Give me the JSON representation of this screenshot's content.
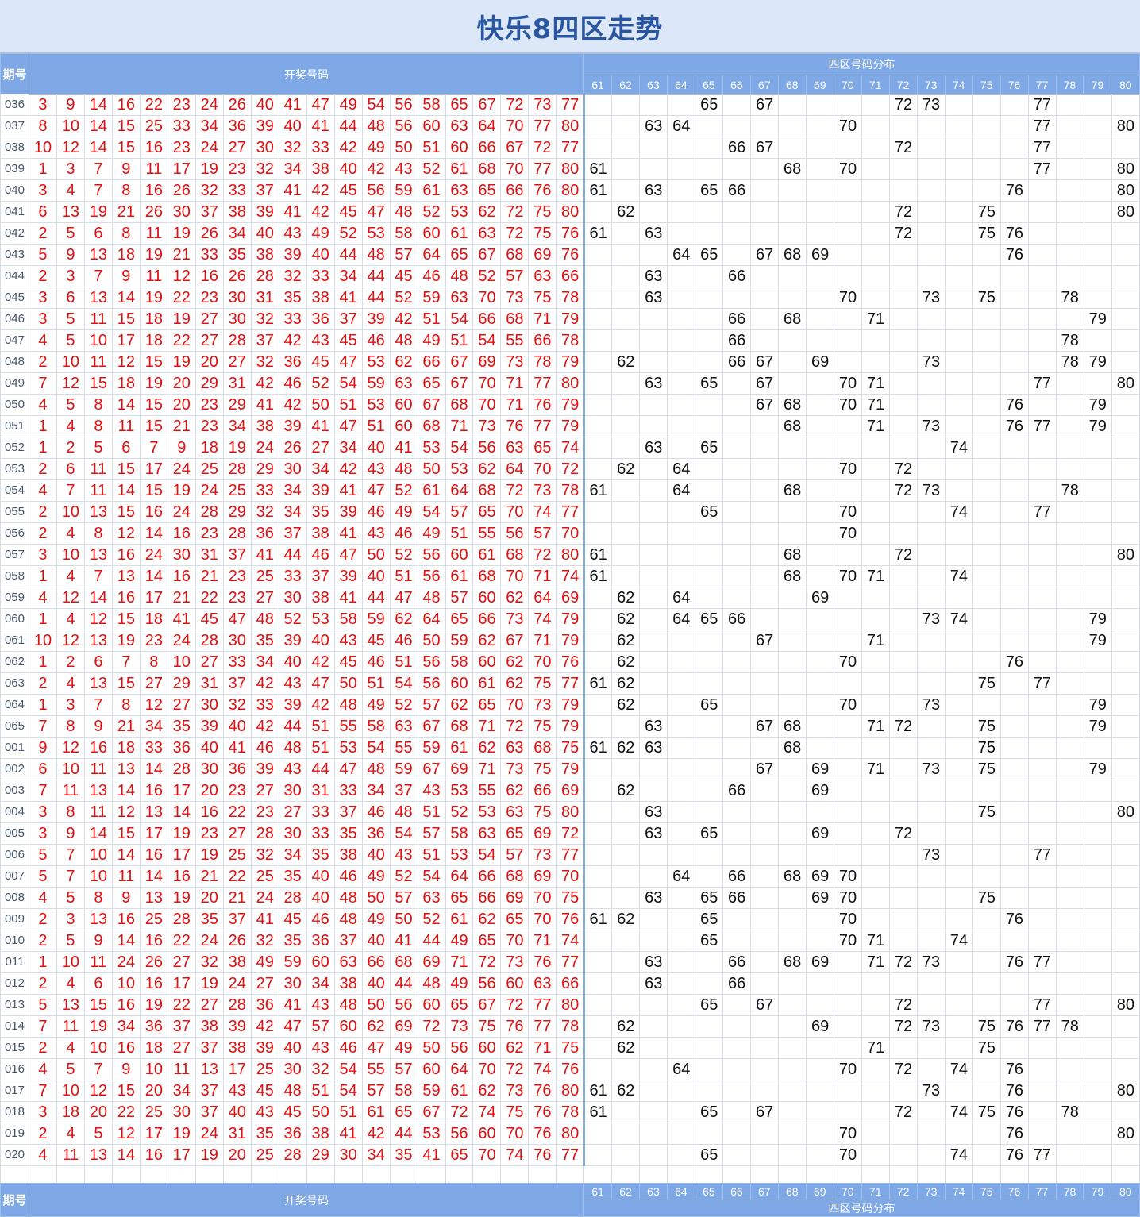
{
  "title": "快乐8四区走势",
  "header": {
    "period_label": "期号",
    "draw_label": "开奖号码",
    "dist_label": "四区号码分布",
    "dist_columns": [
      "61",
      "62",
      "63",
      "64",
      "65",
      "66",
      "67",
      "68",
      "69",
      "70",
      "71",
      "72",
      "73",
      "74",
      "75",
      "76",
      "77",
      "78",
      "79",
      "80"
    ]
  },
  "rows": [
    {
      "period": "036",
      "nums": [
        3,
        9,
        14,
        16,
        22,
        23,
        24,
        26,
        40,
        41,
        47,
        49,
        54,
        56,
        58,
        65,
        67,
        72,
        73,
        77
      ]
    },
    {
      "period": "037",
      "nums": [
        8,
        10,
        14,
        15,
        25,
        33,
        34,
        36,
        39,
        40,
        41,
        44,
        48,
        56,
        60,
        63,
        64,
        70,
        77,
        80
      ]
    },
    {
      "period": "038",
      "nums": [
        10,
        12,
        14,
        15,
        16,
        23,
        24,
        27,
        30,
        32,
        33,
        42,
        49,
        50,
        51,
        60,
        66,
        67,
        72,
        77
      ]
    },
    {
      "period": "039",
      "nums": [
        1,
        3,
        7,
        9,
        11,
        17,
        19,
        23,
        32,
        34,
        38,
        40,
        42,
        43,
        52,
        61,
        68,
        70,
        77,
        80
      ]
    },
    {
      "period": "040",
      "nums": [
        3,
        4,
        7,
        8,
        16,
        26,
        32,
        33,
        37,
        41,
        42,
        45,
        56,
        59,
        61,
        63,
        65,
        66,
        76,
        80
      ]
    },
    {
      "period": "041",
      "nums": [
        6,
        13,
        19,
        21,
        26,
        30,
        37,
        38,
        39,
        41,
        42,
        45,
        47,
        48,
        52,
        53,
        62,
        72,
        75,
        80
      ]
    },
    {
      "period": "042",
      "nums": [
        2,
        5,
        6,
        8,
        11,
        19,
        26,
        34,
        40,
        43,
        49,
        52,
        53,
        58,
        60,
        61,
        63,
        72,
        75,
        76
      ]
    },
    {
      "period": "043",
      "nums": [
        5,
        9,
        13,
        18,
        19,
        21,
        33,
        35,
        38,
        39,
        40,
        44,
        48,
        57,
        64,
        65,
        67,
        68,
        69,
        76
      ]
    },
    {
      "period": "044",
      "nums": [
        2,
        3,
        7,
        9,
        11,
        12,
        16,
        26,
        28,
        32,
        33,
        34,
        44,
        45,
        46,
        48,
        52,
        57,
        63,
        66
      ]
    },
    {
      "period": "045",
      "nums": [
        3,
        6,
        13,
        14,
        19,
        22,
        23,
        30,
        31,
        35,
        38,
        41,
        44,
        52,
        59,
        63,
        70,
        73,
        75,
        78
      ]
    },
    {
      "period": "046",
      "nums": [
        3,
        5,
        11,
        15,
        18,
        19,
        27,
        30,
        32,
        33,
        36,
        37,
        39,
        42,
        51,
        54,
        66,
        68,
        71,
        79
      ]
    },
    {
      "period": "047",
      "nums": [
        4,
        5,
        10,
        17,
        18,
        22,
        27,
        28,
        37,
        42,
        43,
        45,
        46,
        48,
        49,
        51,
        54,
        55,
        66,
        78
      ]
    },
    {
      "period": "048",
      "nums": [
        2,
        10,
        11,
        12,
        15,
        19,
        20,
        27,
        32,
        36,
        45,
        47,
        53,
        62,
        66,
        67,
        69,
        73,
        78,
        79
      ]
    },
    {
      "period": "049",
      "nums": [
        7,
        12,
        15,
        18,
        19,
        20,
        29,
        31,
        42,
        46,
        52,
        54,
        59,
        63,
        65,
        67,
        70,
        71,
        77,
        80
      ]
    },
    {
      "period": "050",
      "nums": [
        4,
        5,
        8,
        14,
        15,
        20,
        23,
        29,
        41,
        42,
        50,
        51,
        53,
        60,
        67,
        68,
        70,
        71,
        76,
        79
      ]
    },
    {
      "period": "051",
      "nums": [
        1,
        4,
        8,
        11,
        15,
        21,
        23,
        34,
        38,
        39,
        41,
        47,
        51,
        60,
        68,
        71,
        73,
        76,
        77,
        79
      ]
    },
    {
      "period": "052",
      "nums": [
        1,
        2,
        5,
        6,
        7,
        9,
        18,
        19,
        24,
        26,
        27,
        34,
        40,
        41,
        53,
        54,
        56,
        63,
        65,
        74
      ]
    },
    {
      "period": "053",
      "nums": [
        2,
        6,
        11,
        15,
        17,
        24,
        25,
        28,
        29,
        30,
        34,
        42,
        43,
        48,
        50,
        53,
        62,
        64,
        70,
        72
      ]
    },
    {
      "period": "054",
      "nums": [
        4,
        7,
        11,
        14,
        15,
        19,
        24,
        25,
        33,
        34,
        39,
        41,
        47,
        52,
        61,
        64,
        68,
        72,
        73,
        78
      ]
    },
    {
      "period": "055",
      "nums": [
        2,
        10,
        13,
        15,
        16,
        24,
        28,
        29,
        32,
        34,
        35,
        39,
        46,
        49,
        54,
        57,
        65,
        70,
        74,
        77
      ]
    },
    {
      "period": "056",
      "nums": [
        2,
        4,
        8,
        12,
        14,
        16,
        23,
        28,
        36,
        37,
        38,
        41,
        43,
        46,
        49,
        51,
        55,
        56,
        57,
        70
      ]
    },
    {
      "period": "057",
      "nums": [
        3,
        10,
        13,
        16,
        24,
        30,
        31,
        37,
        41,
        44,
        46,
        47,
        50,
        52,
        56,
        60,
        61,
        68,
        72,
        80
      ]
    },
    {
      "period": "058",
      "nums": [
        1,
        4,
        7,
        13,
        14,
        16,
        21,
        23,
        25,
        33,
        37,
        39,
        40,
        51,
        56,
        61,
        68,
        70,
        71,
        74
      ]
    },
    {
      "period": "059",
      "nums": [
        4,
        12,
        14,
        16,
        17,
        21,
        22,
        23,
        27,
        30,
        38,
        41,
        44,
        47,
        48,
        57,
        60,
        62,
        64,
        69
      ]
    },
    {
      "period": "060",
      "nums": [
        1,
        4,
        12,
        15,
        18,
        41,
        45,
        47,
        48,
        52,
        53,
        58,
        59,
        62,
        64,
        65,
        66,
        73,
        74,
        79
      ]
    },
    {
      "period": "061",
      "nums": [
        10,
        12,
        13,
        19,
        23,
        24,
        28,
        30,
        35,
        39,
        40,
        43,
        45,
        46,
        50,
        59,
        62,
        67,
        71,
        79
      ]
    },
    {
      "period": "062",
      "nums": [
        1,
        2,
        6,
        7,
        8,
        10,
        27,
        33,
        34,
        40,
        42,
        45,
        46,
        51,
        56,
        58,
        60,
        62,
        70,
        76
      ]
    },
    {
      "period": "063",
      "nums": [
        2,
        4,
        13,
        15,
        27,
        29,
        31,
        37,
        42,
        43,
        47,
        50,
        51,
        54,
        56,
        60,
        61,
        62,
        75,
        77
      ]
    },
    {
      "period": "064",
      "nums": [
        1,
        3,
        7,
        8,
        12,
        27,
        30,
        32,
        33,
        39,
        42,
        48,
        49,
        52,
        57,
        62,
        65,
        70,
        73,
        79
      ]
    },
    {
      "period": "065",
      "nums": [
        7,
        8,
        9,
        21,
        34,
        35,
        39,
        40,
        42,
        44,
        51,
        55,
        58,
        63,
        67,
        68,
        71,
        72,
        75,
        79
      ]
    },
    {
      "period": "001",
      "nums": [
        9,
        12,
        16,
        18,
        33,
        36,
        40,
        41,
        46,
        48,
        51,
        53,
        54,
        55,
        59,
        61,
        62,
        63,
        68,
        75
      ]
    },
    {
      "period": "002",
      "nums": [
        6,
        10,
        11,
        13,
        14,
        28,
        30,
        36,
        39,
        43,
        44,
        47,
        48,
        59,
        67,
        69,
        71,
        73,
        75,
        79
      ]
    },
    {
      "period": "003",
      "nums": [
        7,
        11,
        13,
        14,
        16,
        17,
        20,
        23,
        27,
        30,
        31,
        33,
        34,
        37,
        43,
        53,
        55,
        62,
        66,
        69
      ]
    },
    {
      "period": "004",
      "nums": [
        3,
        8,
        11,
        12,
        13,
        14,
        16,
        22,
        23,
        27,
        33,
        37,
        46,
        48,
        51,
        52,
        53,
        63,
        75,
        80
      ]
    },
    {
      "period": "005",
      "nums": [
        3,
        9,
        14,
        15,
        17,
        19,
        23,
        27,
        28,
        30,
        33,
        35,
        36,
        54,
        57,
        58,
        63,
        65,
        69,
        72
      ]
    },
    {
      "period": "006",
      "nums": [
        5,
        7,
        10,
        14,
        16,
        17,
        19,
        25,
        32,
        34,
        35,
        38,
        40,
        43,
        51,
        53,
        54,
        57,
        73,
        77
      ]
    },
    {
      "period": "007",
      "nums": [
        5,
        7,
        10,
        11,
        14,
        16,
        21,
        22,
        25,
        35,
        40,
        46,
        49,
        52,
        54,
        64,
        66,
        68,
        69,
        70
      ]
    },
    {
      "period": "008",
      "nums": [
        4,
        5,
        8,
        9,
        13,
        19,
        20,
        21,
        24,
        28,
        40,
        48,
        50,
        57,
        63,
        65,
        66,
        69,
        70,
        75
      ]
    },
    {
      "period": "009",
      "nums": [
        2,
        3,
        13,
        16,
        25,
        28,
        35,
        37,
        41,
        45,
        46,
        48,
        49,
        50,
        52,
        61,
        62,
        65,
        70,
        76
      ]
    },
    {
      "period": "010",
      "nums": [
        2,
        5,
        9,
        14,
        16,
        22,
        24,
        26,
        32,
        35,
        36,
        37,
        40,
        41,
        44,
        49,
        65,
        70,
        71,
        74
      ]
    },
    {
      "period": "011",
      "nums": [
        1,
        10,
        11,
        24,
        26,
        27,
        32,
        38,
        49,
        59,
        60,
        63,
        66,
        68,
        69,
        71,
        72,
        73,
        76,
        77
      ]
    },
    {
      "period": "012",
      "nums": [
        2,
        4,
        6,
        10,
        16,
        17,
        19,
        24,
        27,
        30,
        34,
        38,
        40,
        44,
        48,
        49,
        56,
        60,
        63,
        66
      ]
    },
    {
      "period": "013",
      "nums": [
        5,
        13,
        15,
        16,
        19,
        22,
        27,
        28,
        36,
        41,
        43,
        48,
        50,
        56,
        60,
        65,
        67,
        72,
        77,
        80
      ]
    },
    {
      "period": "014",
      "nums": [
        7,
        11,
        19,
        34,
        36,
        37,
        38,
        39,
        42,
        47,
        57,
        60,
        62,
        69,
        72,
        73,
        75,
        76,
        77,
        78
      ]
    },
    {
      "period": "015",
      "nums": [
        2,
        4,
        10,
        16,
        18,
        27,
        37,
        38,
        39,
        40,
        43,
        46,
        47,
        49,
        50,
        56,
        60,
        62,
        71,
        75
      ]
    },
    {
      "period": "016",
      "nums": [
        4,
        5,
        7,
        9,
        10,
        11,
        13,
        17,
        25,
        30,
        32,
        54,
        55,
        57,
        60,
        64,
        70,
        72,
        74,
        76
      ]
    },
    {
      "period": "017",
      "nums": [
        7,
        10,
        12,
        15,
        20,
        34,
        37,
        43,
        45,
        48,
        51,
        54,
        57,
        58,
        59,
        61,
        62,
        73,
        76,
        80
      ]
    },
    {
      "period": "018",
      "nums": [
        3,
        18,
        20,
        22,
        25,
        30,
        37,
        40,
        43,
        45,
        50,
        51,
        61,
        65,
        67,
        72,
        74,
        75,
        76,
        78
      ]
    },
    {
      "period": "019",
      "nums": [
        2,
        4,
        5,
        12,
        17,
        19,
        24,
        31,
        35,
        36,
        38,
        41,
        42,
        44,
        53,
        56,
        60,
        70,
        76,
        80
      ]
    },
    {
      "period": "020",
      "nums": [
        4,
        11,
        13,
        14,
        16,
        17,
        19,
        20,
        25,
        28,
        29,
        30,
        34,
        35,
        41,
        65,
        70,
        74,
        76,
        77
      ]
    }
  ],
  "colors": {
    "number_red": "#e01010",
    "header_blue": "#7fa8e6",
    "title_blue": "#2a55a0",
    "title_bg": "#dce8f8"
  }
}
